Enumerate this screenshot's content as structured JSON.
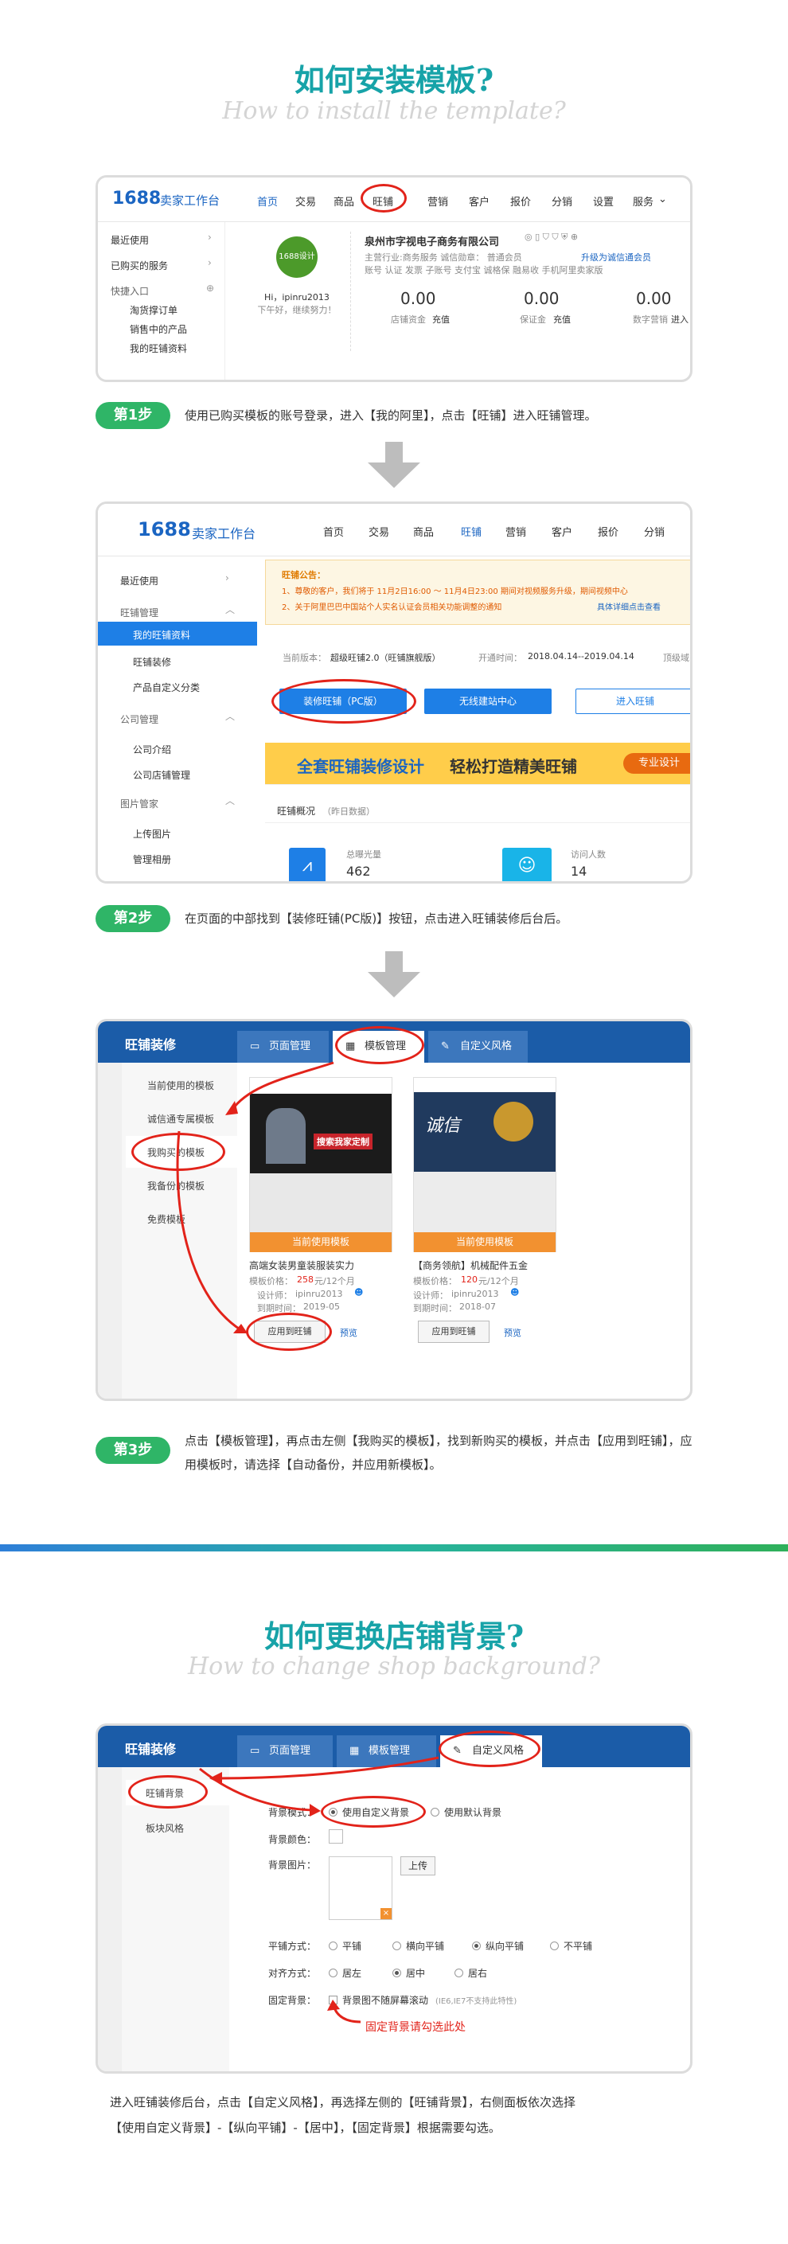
{
  "section1": {
    "title": "如何安装模板?",
    "subtitle": "How to install the template?"
  },
  "shot1": {
    "logo": "1688",
    "logo_text": "卖家工作台",
    "nav": [
      "首页",
      "交易",
      "商品",
      "旺铺",
      "营销",
      "客户",
      "报价",
      "分销",
      "设置",
      "服务"
    ],
    "side": [
      "最近使用",
      "已购买的服务",
      "快捷入口",
      "淘货撑订单",
      "销售中的产品",
      "我的旺铺资料"
    ],
    "avatar_text": "1688设计",
    "greeting": "Hi，ipinru2013",
    "greeting_sub": "下午好，继续努力！",
    "company": "泉州市字视电子商务有限公司",
    "meta1": "主营行业:商务服务  诚信勋章：   普通会员",
    "upgrade": "升级为诚信通会员",
    "meta2": "账号  认证  发票  子账号  支付宝  诚格保  融易收  手机阿里卖家版",
    "stats": [
      {
        "value": "0.00",
        "label": "店铺资金",
        "action": "充值"
      },
      {
        "value": "0.00",
        "label": "保证金",
        "action": "充值"
      },
      {
        "value": "0.00",
        "label": "数字营销",
        "action": "进入"
      }
    ]
  },
  "step1": {
    "label": "第1步",
    "text": "使用已购买模板的账号登录，进入【我的阿里】，点击【旺铺】进入旺铺管理。"
  },
  "shot2": {
    "logo": "1688",
    "logo_text": "卖家工作台",
    "nav": [
      "首页",
      "交易",
      "商品",
      "旺铺",
      "营销",
      "客户",
      "报价",
      "分销"
    ],
    "side": [
      {
        "label": "最近使用",
        "cls": "h"
      },
      {
        "label": "旺铺管理",
        "cls": "h"
      },
      {
        "label": "我的旺铺资料",
        "cls": "active"
      },
      {
        "label": "旺铺装修",
        "cls": "s"
      },
      {
        "label": "产品自定义分类",
        "cls": "s"
      },
      {
        "label": "公司管理",
        "cls": "h"
      },
      {
        "label": "公司介绍",
        "cls": "s"
      },
      {
        "label": "公司店铺管理",
        "cls": "s"
      },
      {
        "label": "图片管家",
        "cls": "h"
      },
      {
        "label": "上传图片",
        "cls": "s"
      },
      {
        "label": "管理相册",
        "cls": "s"
      }
    ],
    "notice_title": "旺铺公告：",
    "notice1": "1、尊敬的客户，我们将于 11月2日16:00 ～ 11月4日23:00 期间对视频服务升级，期间视频中心",
    "notice2": "2、关于阿里巴巴中国站个人实名认证会员相关功能调整的通知",
    "notice2_link": "具体详细点击查看",
    "version_label": "当前版本：",
    "version": "超级旺铺2.0（旺铺旗舰版）",
    "open_label": "开通时间：",
    "open_time": "2018.04.14--2019.04.14",
    "extra": "顶级域",
    "btn_decorate": "装修旺铺（PC版）",
    "btn_wireless": "无线建站中心",
    "btn_enter": "进入旺铺",
    "banner": "全套旺铺装修设计",
    "banner_bold": "轻松打造精美旺铺",
    "banner_tag": "专业设计",
    "overview": "旺铺概况",
    "overview_sub": "（昨日数据）",
    "stat1_label": "总曝光量",
    "stat1_value": "462",
    "stat2_label": "访问人数",
    "stat2_value": "14"
  },
  "step2": {
    "label": "第2步",
    "text": "在页面的中部找到【装修旺铺(PC版)】按钮，点击进入旺铺装修后台后。"
  },
  "shot3": {
    "header": "旺铺装修",
    "tabs": [
      "页面管理",
      "模板管理",
      "自定义风格"
    ],
    "side": [
      "当前使用的模板",
      "诚信通专属模板",
      "我购买的模板",
      "我备份的模板",
      "免费模板"
    ],
    "cards": [
      {
        "badge": "当前使用模板",
        "name": "高端女装男童装服装实力",
        "price_label": "模板价格：",
        "price": "258",
        "price_unit": "元/12个月",
        "designer_label": "设计师：",
        "designer": "ipinru2013",
        "expire_label": "到期时间：",
        "expire": "2019-05",
        "apply": "应用到旺铺",
        "preview": "预览",
        "hero": "搜索我家定制"
      },
      {
        "badge": "当前使用模板",
        "name": "【商务领航】机械配件五金",
        "price_label": "模板价格：",
        "price": "120",
        "price_unit": "元/12个月",
        "designer_label": "设计师：",
        "designer": "ipinru2013",
        "expire_label": "到期时间：",
        "expire": "2018-07",
        "apply": "应用到旺铺",
        "preview": "预览",
        "hero": "诚信"
      }
    ]
  },
  "step3": {
    "label": "第3步",
    "text": "点击【模板管理】，再点击左侧【我购买的模板】，找到新购买的模板，并点击【应用到旺铺】，应用模板时，请选择【自动备份，并应用新模板】。"
  },
  "section2": {
    "title": "如何更换店铺背景?",
    "subtitle": "How to change shop background?"
  },
  "shot4": {
    "header": "旺铺装修",
    "tabs": [
      "页面管理",
      "模板管理",
      "自定义风格"
    ],
    "side": [
      "旺铺背景",
      "板块风格"
    ],
    "mode_label": "背景模式：",
    "mode_opts": [
      "使用自定义背景",
      "使用默认背景"
    ],
    "color_label": "背景颜色：",
    "image_label": "背景图片：",
    "upload": "上传",
    "tile_label": "平铺方式：",
    "tile_opts": [
      "平铺",
      "横向平铺",
      "纵向平铺",
      "不平铺"
    ],
    "align_label": "对齐方式：",
    "align_opts": [
      "居左",
      "居中",
      "居右"
    ],
    "fixed_label": "固定背景：",
    "fixed_opt": "背景图不随屏幕滚动",
    "fixed_note": "(IE6,IE7不支持此特性)",
    "hint": "固定背景请勾选此处"
  },
  "final": {
    "line1": "进入旺铺装修后台，点击【自定义风格】，再选择左侧的【旺铺背景】，右侧面板依次选择",
    "line2": "【使用自定义背景】-【纵向平铺】-【居中】，【固定背景】根据需要勾选。"
  },
  "colors": {
    "accent": "#17a3a8",
    "step": "#2fb567",
    "brand": "#1b65c2",
    "red": "#e2231a"
  }
}
